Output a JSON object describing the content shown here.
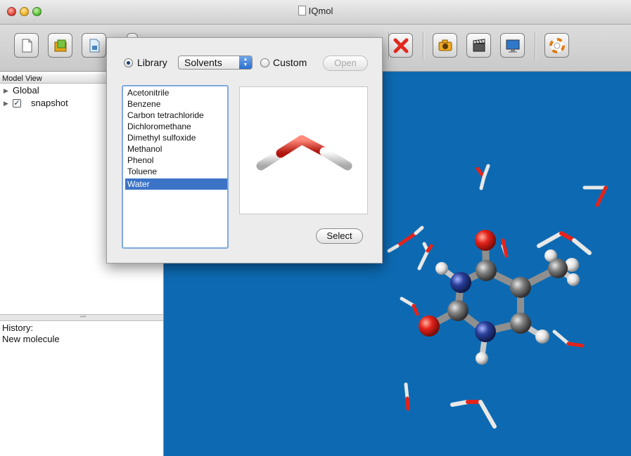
{
  "window": {
    "title": "IQmol"
  },
  "model_view": {
    "header": "Model View",
    "items": [
      {
        "label": "Global",
        "checked": false
      },
      {
        "label": "snapshot",
        "checked": true
      }
    ]
  },
  "history": {
    "title": "History:",
    "items": [
      "New molecule"
    ]
  },
  "dialog": {
    "library_label": "Library",
    "library_selected": true,
    "dropdown_value": "Solvents",
    "custom_label": "Custom",
    "open_label": "Open",
    "select_label": "Select",
    "solvents": [
      "Acetonitrile",
      "Benzene",
      "Carbon tetrachloride",
      "Dichloromethane",
      "Dimethyl sulfoxide",
      "Methanol",
      "Phenol",
      "Toluene",
      "Water"
    ],
    "selected_solvent": "Water"
  },
  "toolbar": {
    "icons": [
      "new-file-icon",
      "open-file-icon",
      "save-file-icon",
      "record-icon",
      "tool-icon",
      "tool-icon",
      "tool-icon",
      "tool-icon",
      "tool-icon",
      "tool-icon",
      "delete-icon",
      "camera-icon",
      "movie-clapper-icon",
      "display-icon",
      "help-lifebuoy-icon"
    ]
  },
  "colors": {
    "viewer_background": "#0d6ab2",
    "selection": "#3b73c7",
    "oxygen": "#e4231b",
    "nitrogen": "#2a3f9a",
    "carbon": "#808080",
    "hydrogen": "#f2f2f2"
  }
}
